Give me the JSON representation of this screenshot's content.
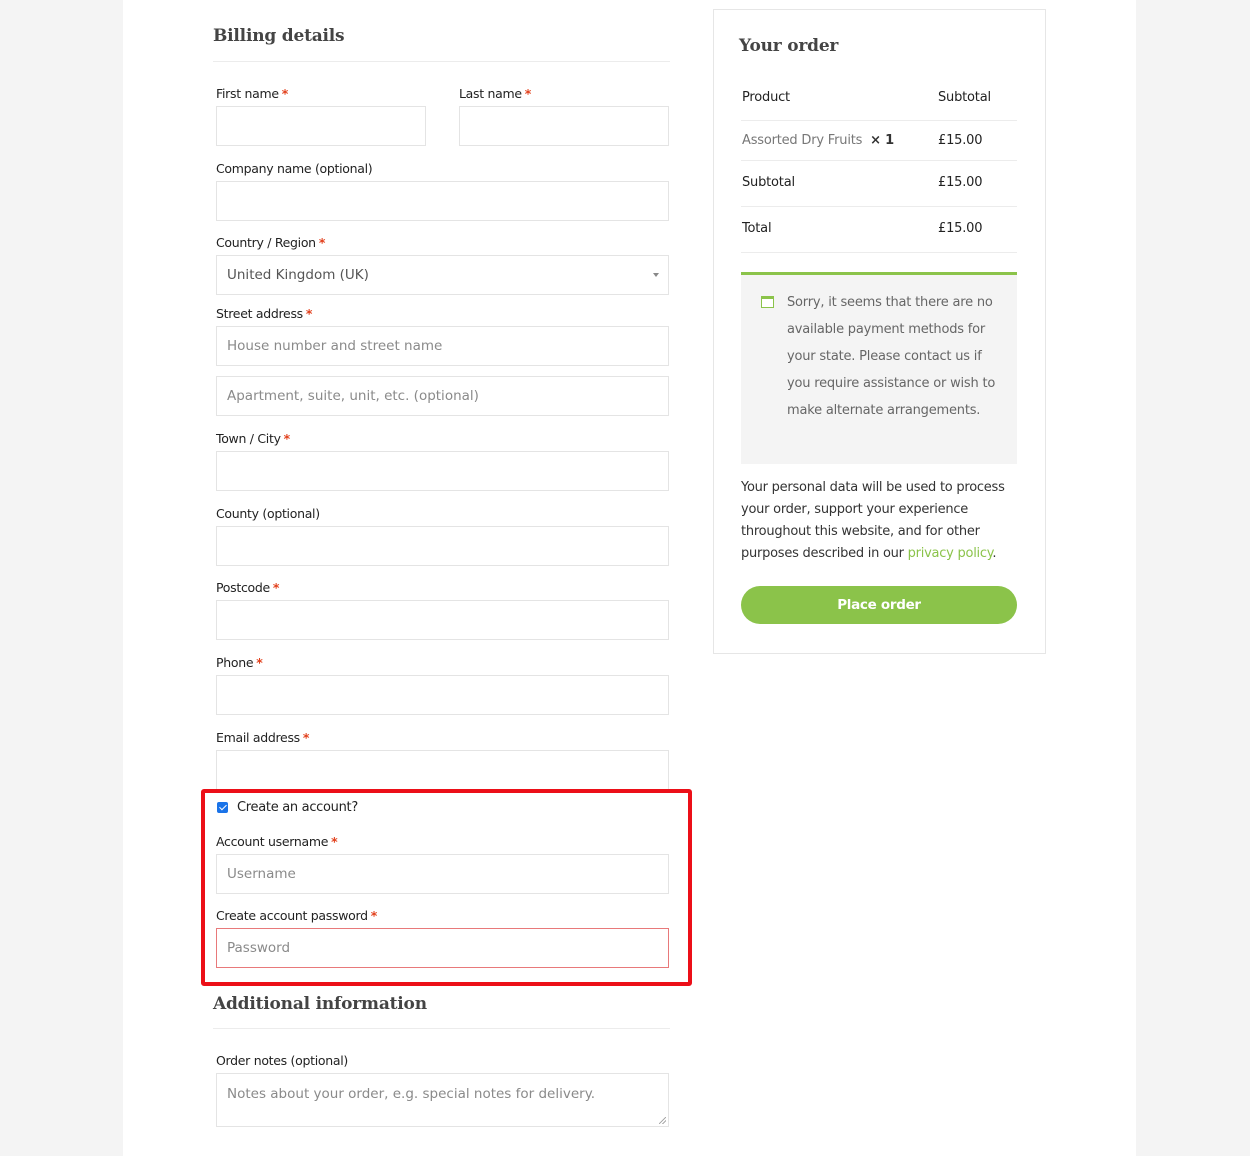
{
  "billing": {
    "title": "Billing details",
    "required_marker": "*",
    "first_name": {
      "label": "First name",
      "value": ""
    },
    "last_name": {
      "label": "Last name",
      "value": ""
    },
    "company": {
      "label": "Company name (optional)",
      "value": ""
    },
    "country": {
      "label": "Country / Region",
      "value": "United Kingdom (UK)"
    },
    "street": {
      "label": "Street address",
      "line1_placeholder": "House number and street name",
      "line2_placeholder": "Apartment, suite, unit, etc. (optional)"
    },
    "town": {
      "label": "Town / City",
      "value": ""
    },
    "county": {
      "label": "County (optional)",
      "value": ""
    },
    "postcode": {
      "label": "Postcode",
      "value": ""
    },
    "phone": {
      "label": "Phone",
      "value": ""
    },
    "email": {
      "label": "Email address",
      "value": ""
    },
    "create_account": {
      "label": "Create an account?",
      "checked": true
    },
    "username": {
      "label": "Account username",
      "placeholder": "Username"
    },
    "password": {
      "label": "Create account password",
      "placeholder": "Password"
    }
  },
  "additional": {
    "title": "Additional information",
    "order_notes": {
      "label": "Order notes (optional)",
      "placeholder": "Notes about your order, e.g. special notes for delivery."
    }
  },
  "order": {
    "title": "Your order",
    "columns": [
      "Product",
      "Subtotal"
    ],
    "items": [
      {
        "name": "Assorted Dry Fruits",
        "quantity": "× 1",
        "subtotal": "£15.00"
      }
    ],
    "subtotal_label": "Subtotal",
    "subtotal_value": "£15.00",
    "total_label": "Total",
    "total_value": "£15.00",
    "payment_notice": "Sorry, it seems that there are no available payment methods for your state. Please contact us if you require assistance or wish to make alternate arrangements.",
    "privacy_text": "Your personal data will be used to process your order, support your experience throughout this website, and for other purposes described in our ",
    "privacy_link": "privacy policy",
    "privacy_end": ".",
    "place_order_label": "Place order"
  },
  "colors": {
    "accent": "#8bc34a",
    "required": "#e2401c",
    "highlight": "#ec0f18",
    "checkbox": "#1a73e8"
  }
}
